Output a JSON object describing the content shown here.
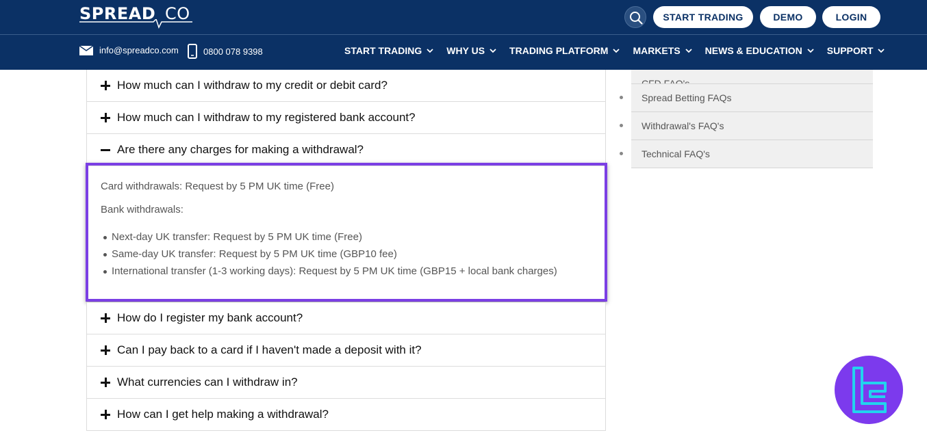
{
  "header": {
    "logo_text": "SPREAD",
    "logo_suffix": "CO",
    "buttons": {
      "start_trading": "START TRADING",
      "demo": "DEMO",
      "login": "LOGIN"
    },
    "email": "info@spreadco.com",
    "phone": "0800 078 9398",
    "nav": [
      "START TRADING",
      "WHY US",
      "TRADING PLATFORM",
      "MARKETS",
      "NEWS & EDUCATION",
      "SUPPORT"
    ]
  },
  "faq": {
    "items_before": [
      "How much can I withdraw to my credit or debit card?",
      "How much can I withdraw to my registered bank account?"
    ],
    "open_item": {
      "question": "Are there any charges for making a withdrawal?",
      "card_line": "Card withdrawals: Request by 5 PM UK time (Free)",
      "bank_heading": "Bank withdrawals:",
      "bank_items": [
        "Next-day UK transfer: Request by 5 PM UK time (Free)",
        "Same-day UK transfer: Request by 5 PM UK time (GBP10 fee)",
        "International transfer (1-3 working days): Request by 5 PM UK time (GBP15 + local bank charges)"
      ]
    },
    "items_after": [
      "How do I register my bank account?",
      "Can I pay back to a card if I haven't made a deposit with it?",
      "What currencies can I withdraw in?",
      "How can I get help making a withdrawal?"
    ]
  },
  "sidebar": {
    "items": [
      "CFD FAQ's",
      "Spread Betting FAQs",
      "Withdrawal's FAQ's",
      "Technical FAQ's"
    ]
  },
  "colors": {
    "header_bg": "#0b3165",
    "highlight": "#7b3fe4",
    "badge": "#7c3aed",
    "badge_accent": "#22d3ee"
  }
}
